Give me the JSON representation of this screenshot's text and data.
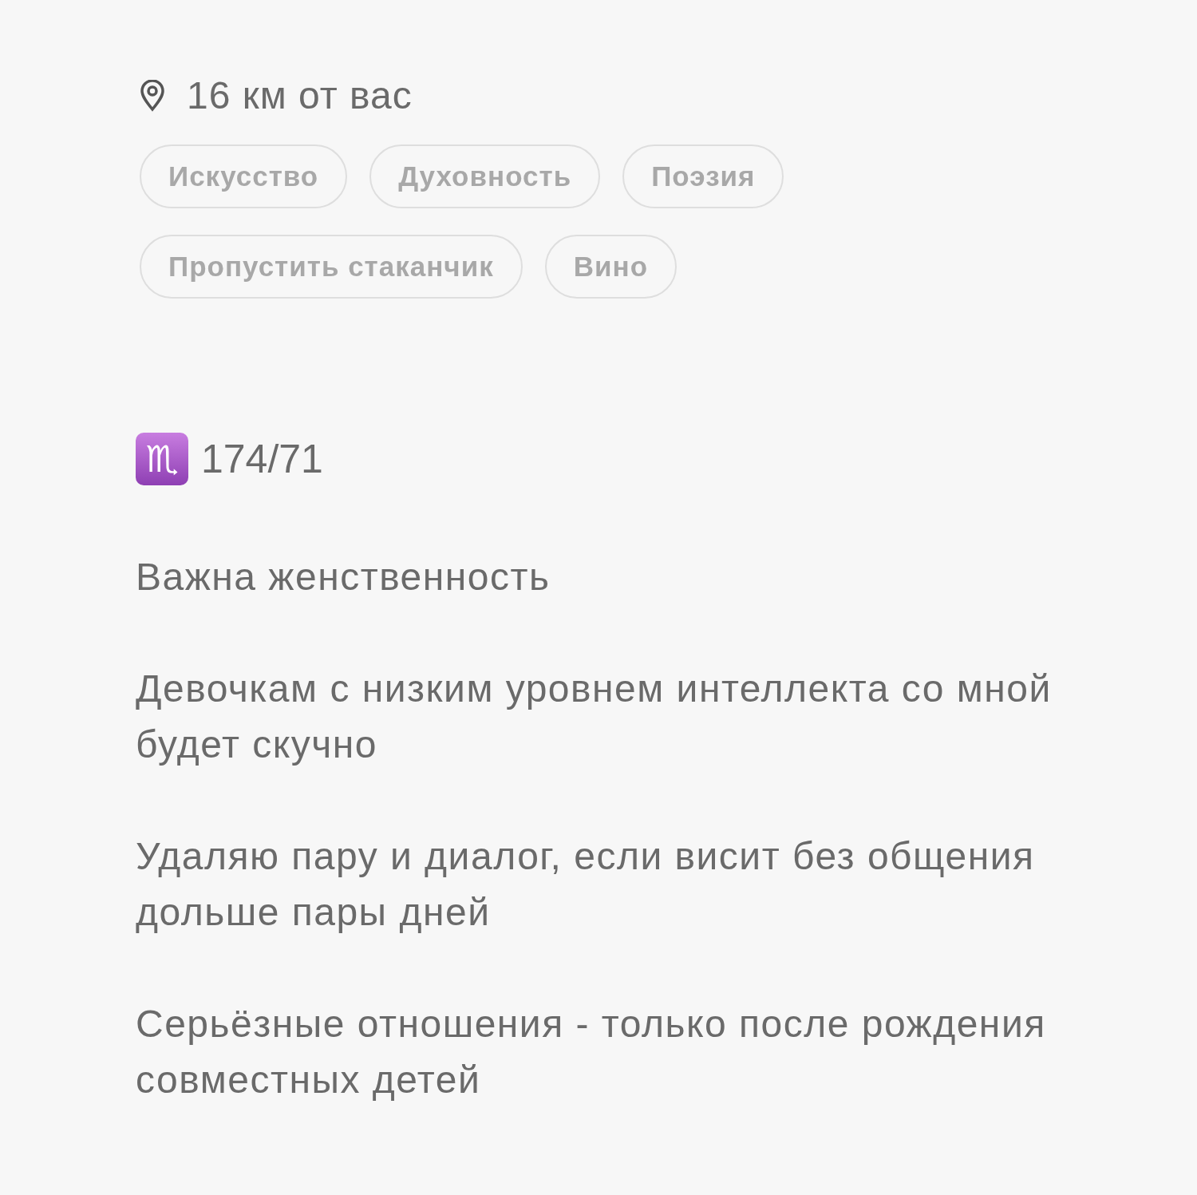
{
  "location": {
    "text": "16 км от вас"
  },
  "interests": [
    {
      "label": "Искусство"
    },
    {
      "label": "Духовность"
    },
    {
      "label": "Поэзия"
    },
    {
      "label": "Пропустить стаканчик"
    },
    {
      "label": "Вино"
    }
  ],
  "stats": {
    "sign": "♏",
    "text": "174/71"
  },
  "bio": [
    "Важна женственность",
    "Девочкам с низким уровнем интеллекта со мной будет скучно",
    "Удаляю пару и диалог, если висит без общения дольше пары дней",
    "Серьёзные отношения - только после рождения совместных детей"
  ]
}
